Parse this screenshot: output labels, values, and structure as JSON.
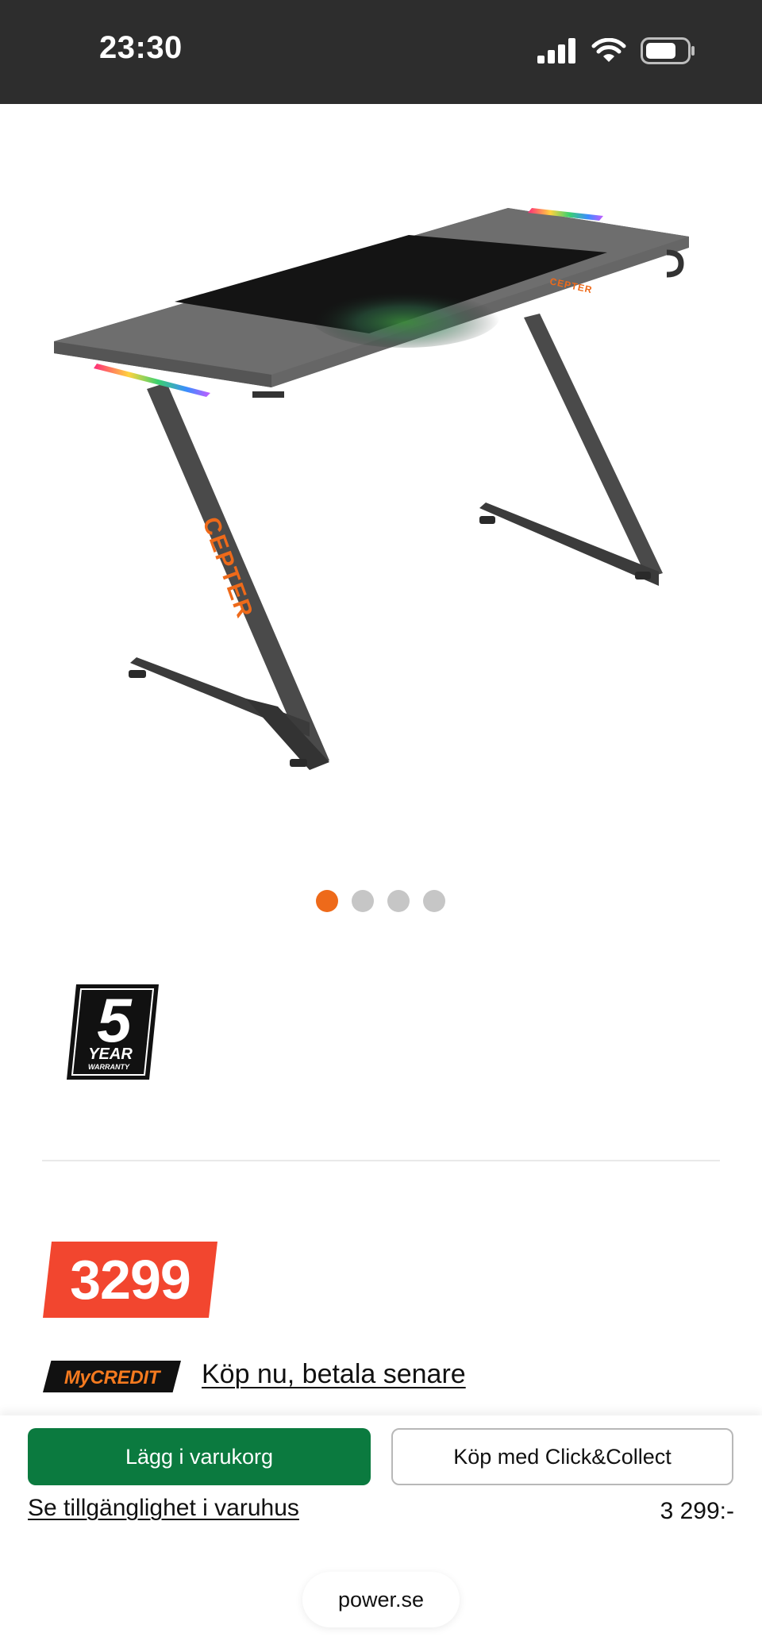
{
  "status_bar": {
    "time": "23:30",
    "icons": [
      "cellular-signal-icon",
      "wifi-icon",
      "battery-icon"
    ]
  },
  "product": {
    "image_name": "gaming-desk-image",
    "brand_marks": [
      "CEPTER",
      "CEPTER"
    ],
    "carousel": {
      "total": 4,
      "active_index": 0
    },
    "warranty_badge": {
      "number": "5",
      "line1": "YEAR",
      "line2": "WARRANTY"
    }
  },
  "pricing": {
    "price_tag": "3299",
    "mycredit_logo": "MyCREDIT",
    "credit_link": "Köp nu, betala senare"
  },
  "bottom_bar": {
    "add_to_cart": "Lägg i varukorg",
    "click_collect": "Köp med Click&Collect",
    "availability_link": "Se tillgänglighet i varuhus",
    "price": "3 299:-"
  },
  "browser": {
    "url": "power.se"
  },
  "colors": {
    "accent_orange": "#ee6a1a",
    "price_red": "#f2462f",
    "cart_green": "#0b7a3f",
    "status_bar": "#2d2d2d"
  }
}
